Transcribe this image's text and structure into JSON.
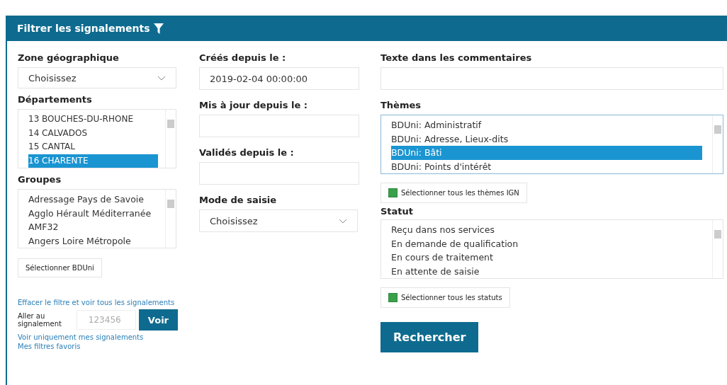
{
  "panel": {
    "title": "Filtrer les signalements"
  },
  "zone": {
    "label": "Zone géographique",
    "value": "Choisissez"
  },
  "departements": {
    "label": "Départements",
    "items": [
      {
        "label": "13 BOUCHES-DU-RHONE",
        "selected": false
      },
      {
        "label": "14 CALVADOS",
        "selected": false
      },
      {
        "label": "15 CANTAL",
        "selected": false
      },
      {
        "label": "16 CHARENTE",
        "selected": true
      }
    ]
  },
  "groupes": {
    "label": "Groupes",
    "items": [
      {
        "label": "Adressage Pays de Savoie",
        "selected": false
      },
      {
        "label": "Agglo Hérault Méditerranée",
        "selected": false
      },
      {
        "label": "AMF32",
        "selected": false
      },
      {
        "label": "Angers Loire Métropole",
        "selected": false
      }
    ]
  },
  "select_bduni": "Sélectionner BDUni",
  "crees": {
    "label": "Créés depuis le :",
    "value": "2019-02-04 00:00:00"
  },
  "mis_a_jour": {
    "label": "Mis à jour depuis le :"
  },
  "valides": {
    "label": "Validés depuis le :"
  },
  "mode": {
    "label": "Mode de saisie",
    "value": "Choisissez"
  },
  "commentaires": {
    "label": "Texte dans les commentaires"
  },
  "themes": {
    "label": "Thèmes",
    "items": [
      {
        "label": "BDUni: Administratif",
        "selected": false
      },
      {
        "label": "BDUni: Adresse, Lieux-dits",
        "selected": false
      },
      {
        "label": "BDUni: Bâti",
        "selected": true
      },
      {
        "label": "BDUni: Points d'intérêt",
        "selected": false
      }
    ]
  },
  "select_all_themes": {
    "label": "Sélectionner tous les thèmes IGN",
    "checked": true
  },
  "statut": {
    "label": "Statut",
    "items": [
      {
        "label": "Reçu dans nos services",
        "selected": false
      },
      {
        "label": "En demande de qualification",
        "selected": false
      },
      {
        "label": "En cours de traitement",
        "selected": false
      },
      {
        "label": "En attente de saisie",
        "selected": false
      }
    ]
  },
  "select_all_statuts": {
    "label": "Sélectionner tous les statuts",
    "checked": true
  },
  "search_button": "Rechercher",
  "clear_link": "Effacer le filtre et voir tous les signalements",
  "goto": {
    "label": "Aller au signalement",
    "placeholder": "123456",
    "button": "Voir"
  },
  "links": [
    "Voir uniquement mes signalements",
    "Mes filtres favoris"
  ]
}
